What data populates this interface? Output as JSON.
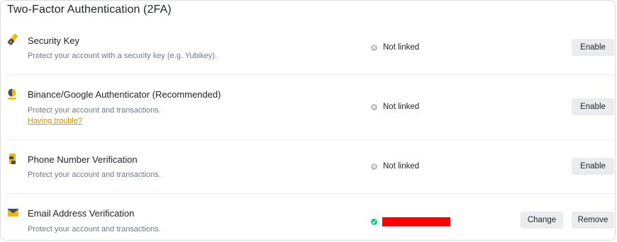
{
  "section_title": "Two-Factor Authentication (2FA)",
  "colors": {
    "accent": "#f0b90b",
    "link": "#c99400",
    "unlinked_icon": "#b7bdc6",
    "linked_icon": "#0ecb81",
    "redaction": "#ff0000",
    "button_bg": "#eaecef"
  },
  "methods": [
    {
      "icon": "security-key-icon",
      "title": "Security Key",
      "description": "Protect your account with a security key (e.g. Yubikey).",
      "status": "Not linked",
      "actions": [
        "Enable"
      ]
    },
    {
      "icon": "authenticator-icon",
      "title": "Binance/Google Authenticator (Recommended)",
      "description": "Protect your account and transactions.",
      "help_link": "Having trouble?",
      "status": "Not linked",
      "actions": [
        "Enable"
      ]
    },
    {
      "icon": "phone-icon",
      "title": "Phone Number Verification",
      "description": "Protect your account and transactions.",
      "status": "Not linked",
      "actions": [
        "Enable"
      ]
    },
    {
      "icon": "email-icon",
      "title": "Email Address Verification",
      "description": "Protect your account and transactions.",
      "status": "linked (value redacted)",
      "actions": [
        "Change",
        "Remove"
      ]
    }
  ]
}
